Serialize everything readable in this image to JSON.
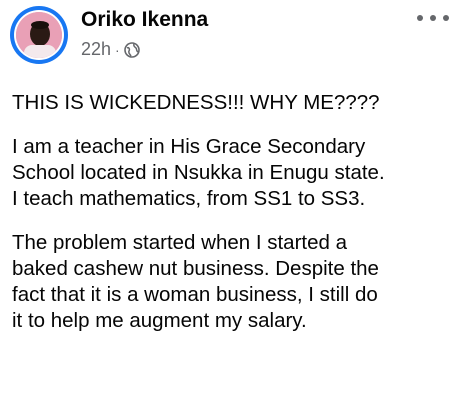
{
  "post": {
    "author_name": "Oriko Ikenna",
    "timestamp": "22h",
    "separator": "·",
    "privacy_icon": "globe-icon",
    "more_icon": "more-options-icon",
    "paragraphs": [
      "THIS IS WICKEDNESS!!! WHY ME????",
      "I am a teacher in His Grace Secondary\nSchool located in Nsukka in Enugu state.\nI teach mathematics, from SS1 to SS3.",
      " The problem started when I started a\nbaked cashew nut business. Despite the\nfact that it is a woman business, I still do\nit to help me augment my salary."
    ]
  },
  "colors": {
    "avatar_ring": "#1877f2",
    "avatar_background": "#e9a0b6",
    "secondary_text": "#65676b",
    "primary_text": "#050505"
  }
}
